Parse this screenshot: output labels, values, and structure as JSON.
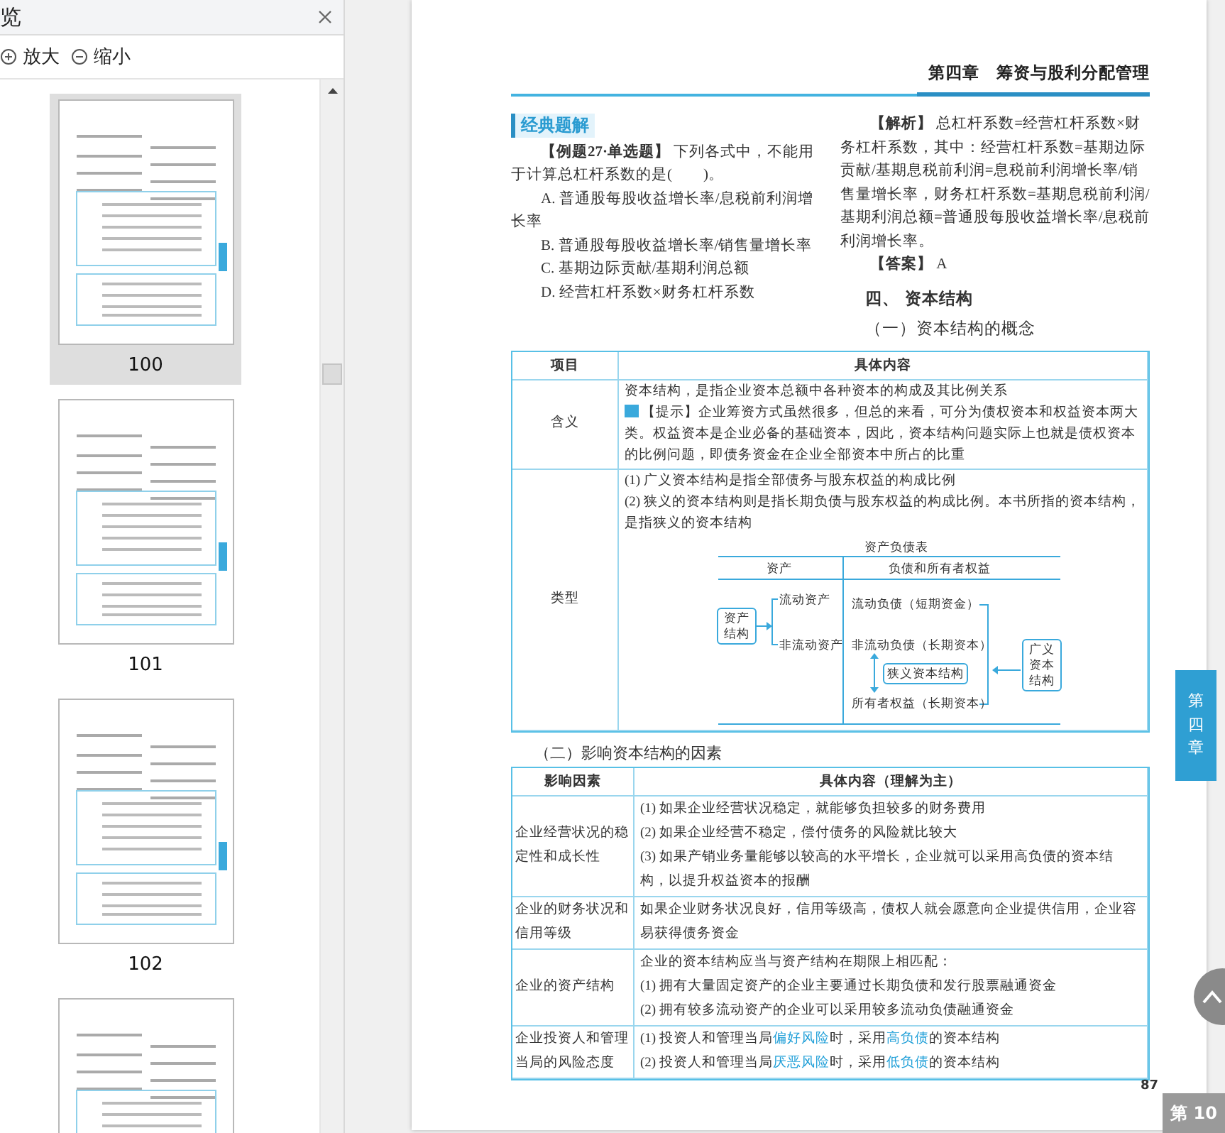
{
  "sidebar": {
    "title": "览",
    "zoom_in": "放大",
    "zoom_out": "缩小",
    "thumbnails": [
      {
        "label": "100",
        "selected": true
      },
      {
        "label": "101",
        "selected": false
      },
      {
        "label": "102",
        "selected": false
      },
      {
        "selected": false
      }
    ]
  },
  "page": {
    "header": "第四章　筹资与股利分配管理",
    "badge": "经典题解",
    "question": "**【例题27·单选题】** 下列各式中，不能用于计算总杠杆系数的是(　　)。",
    "options": [
      "A. 普通股每股收益增长率/息税前利润增长率",
      "B. 普通股每股收益增长率/销售量增长率",
      "C. 基期边际贡献/基期利润总额",
      "D. 经营杠杆系数×财务杠杆系数"
    ],
    "analysis": "**【解析】** 总杠杆系数=经营杠杆系数×财务杠杆系数，其中：经营杠杆系数=基期边际贡献/基期息税前利润=息税前利润增长率/销售量增长率，财务杠杆系数=基期息税前利润/基期利润总额=普通股每股收益增长率/息税前利润增长率。",
    "answer": "**【答案】** A",
    "heading": "四、 资本结构",
    "subheading": "（一）资本结构的概念",
    "table1": {
      "columns": [
        "项目",
        "具体内容"
      ],
      "meaning": {
        "label": "含义",
        "text": "资本结构，是指企业资本总额中各种资本的构成及其比例关系",
        "tip": "【提示】企业筹资方式虽然很多，但总的来看，可分为债权资本和权益资本两大类。权益资本是企业必备的基础资本，因此，资本结构问题实际上也就是债权资本的比例问题，即债务资金在企业全部资本中所占的比重"
      },
      "types": {
        "label": "类型",
        "lines": [
          "(1) 广义资本结构是指全部债务与股东权益的构成比例",
          "(2) 狭义的资本结构则是指长期负债与股东权益的构成比例。本书所指的资本结构，是指狭义的资本结构"
        ],
        "diagram": {
          "title": "资产负债表",
          "left_header": "资产",
          "right_header": "负债和所有者权益",
          "asset_box": "资产结构",
          "assets": [
            "流动资产",
            "非流动资产"
          ],
          "liabilities": [
            "流动负债（短期资金）",
            "非流动负债（长期资本）"
          ],
          "narrow_box": "狭义资本结构",
          "equity": "所有者权益（长期资本）",
          "broad_box": "广义资本结构"
        }
      }
    },
    "subheading2": "（二）影响资本结构的因素",
    "table2": {
      "columns": [
        "影响因素",
        "具体内容（理解为主）"
      ],
      "rows": [
        {
          "factor": "企业经营状况的稳定性和成长性",
          "lines": [
            [
              {
                "text": "(1) 如果企业经营状况稳定，就能够负担较多的财务费用",
                "highlight": false
              }
            ],
            [
              {
                "text": "(2) 如果企业经营不稳定，偿付债务的风险就比较大",
                "highlight": false
              }
            ],
            [
              {
                "text": "(3) 如果产销业务量能够以较高的水平增长，企业就可以采用高负债的资本结构，以提升权益资本的报酬",
                "highlight": false
              }
            ]
          ]
        },
        {
          "factor": "企业的财务状况和信用等级",
          "lines": [
            [
              {
                "text": "如果企业财务状况良好，信用等级高，债权人就会愿意向企业提供信用，企业容易获得债务资金",
                "highlight": false
              }
            ]
          ]
        },
        {
          "factor": "企业的资产结构",
          "lines": [
            [
              {
                "text": "企业的资本结构应当与资产结构在期限上相匹配：",
                "highlight": false
              }
            ],
            [
              {
                "text": "(1) 拥有大量固定资产的企业主要通过长期负债和发行股票融通资金",
                "highlight": false
              }
            ],
            [
              {
                "text": "(2) 拥有较多流动资产的企业可以采用较多流动负债融通资金",
                "highlight": false
              }
            ]
          ]
        },
        {
          "factor": "企业投资人和管理当局的风险态度",
          "lines": [
            [
              {
                "text": "(1) 投资人和管理当局",
                "highlight": false
              },
              {
                "text": "偏好风险",
                "highlight": true
              },
              {
                "text": "时，采用",
                "highlight": false
              },
              {
                "text": "高负债",
                "highlight": true
              },
              {
                "text": "的资本结构",
                "highlight": false
              }
            ],
            [
              {
                "text": "(2) 投资人和管理当局",
                "highlight": false
              },
              {
                "text": "厌恶风险",
                "highlight": true
              },
              {
                "text": "时，采用",
                "highlight": false
              },
              {
                "text": "低负债",
                "highlight": true
              },
              {
                "text": "的资本结构",
                "highlight": false
              }
            ]
          ]
        }
      ]
    },
    "page_number": "87",
    "chapter_tab": "第四章"
  },
  "viewer": {
    "page_indicator": "第 10"
  }
}
